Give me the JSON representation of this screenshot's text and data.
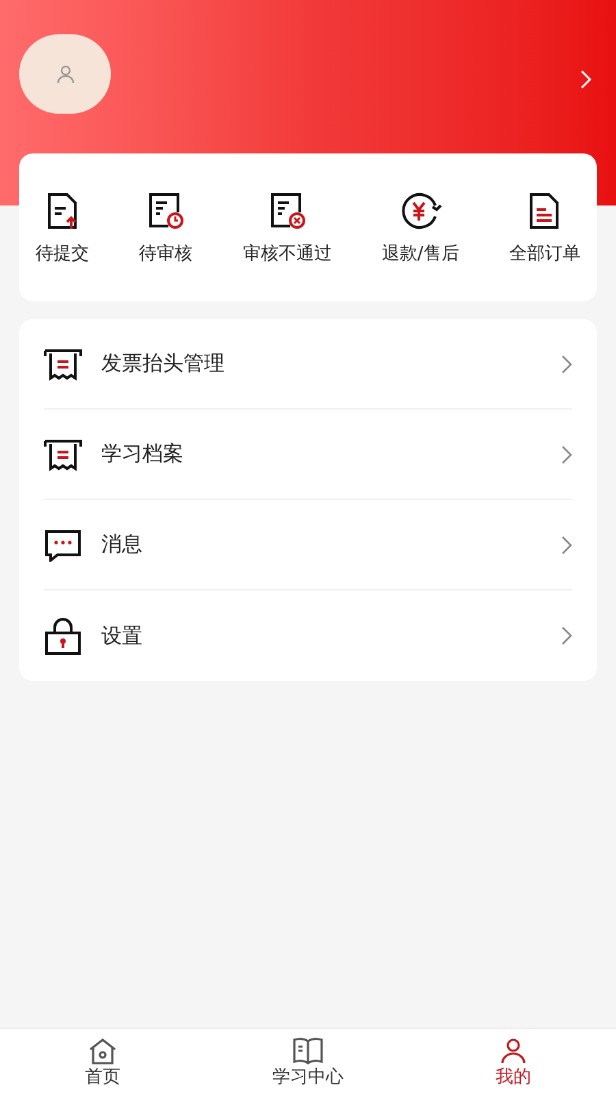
{
  "orders": [
    {
      "label": "待提交"
    },
    {
      "label": "待审核"
    },
    {
      "label": "审核不通过"
    },
    {
      "label": "退款/售后"
    },
    {
      "label": "全部订单"
    }
  ],
  "menu": [
    {
      "label": "发票抬头管理"
    },
    {
      "label": "学习档案"
    },
    {
      "label": "消息"
    },
    {
      "label": "设置"
    }
  ],
  "tabs": [
    {
      "label": "首页",
      "selected": false
    },
    {
      "label": "学习中心",
      "selected": false
    },
    {
      "label": "我的",
      "selected": true
    }
  ]
}
